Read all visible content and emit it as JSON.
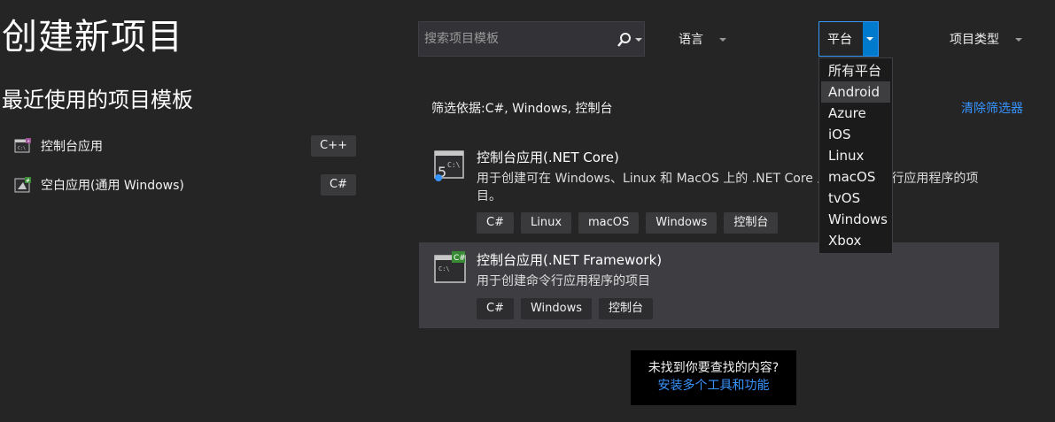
{
  "header": {
    "title": "创建新项目"
  },
  "recent": {
    "title": "最近使用的项目模板",
    "items": [
      {
        "label": "控制台应用",
        "lang": "C++",
        "icon": "console-app-icon"
      },
      {
        "label": "空白应用(通用 Windows)",
        "lang": "C#",
        "icon": "blank-uwp-app-icon"
      }
    ]
  },
  "search": {
    "placeholder": "搜索项目模板",
    "value": "",
    "icon": "search-icon"
  },
  "filters": {
    "language": {
      "label": "语言"
    },
    "platform": {
      "label": "平台",
      "open": true,
      "options": [
        "所有平台",
        "Android",
        "Azure",
        "iOS",
        "Linux",
        "macOS",
        "tvOS",
        "Windows",
        "Xbox"
      ],
      "highlighted": "Android"
    },
    "project_type": {
      "label": "项目类型"
    },
    "summary": "筛选依据:C#, Windows, 控制台",
    "clear_label": "清除筛选器"
  },
  "templates": [
    {
      "title": "控制台应用(.NET Core)",
      "description": "用于创建可在 Windows、Linux 和 MacOS 上的 .NET Core 上运行的命令行应用程序的项目。",
      "tags": [
        "C#",
        "Linux",
        "macOS",
        "Windows",
        "控制台"
      ],
      "icon": "dotnet-core-console-icon",
      "selected": false
    },
    {
      "title": "控制台应用(.NET Framework)",
      "description": "用于创建命令行应用程序的项目",
      "tags": [
        "C#",
        "Windows",
        "控制台"
      ],
      "icon": "csharp-console-icon",
      "selected": true
    }
  ],
  "not_found": {
    "question": "未找到你要查找的内容?",
    "link": "安装多个工具和功能"
  },
  "colors": {
    "background": "#252526",
    "accent": "#007acc",
    "link": "#3794ff",
    "selected_row": "#3e3e42"
  }
}
